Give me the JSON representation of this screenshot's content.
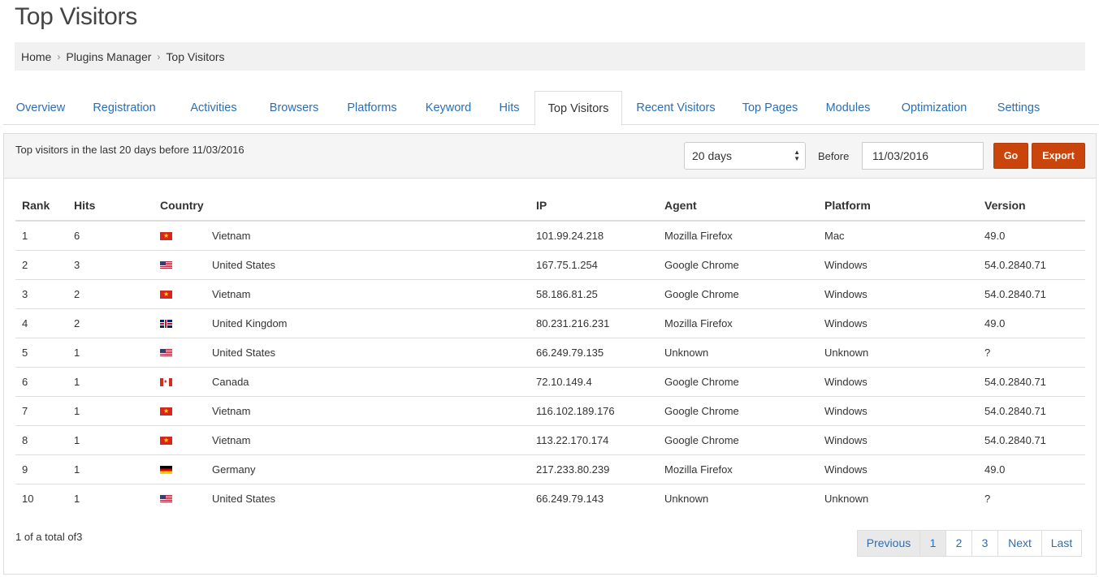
{
  "page": {
    "title": "Top Visitors"
  },
  "breadcrumb": [
    "Home",
    "Plugins Manager",
    "Top Visitors"
  ],
  "tabs": [
    {
      "label": "Overview"
    },
    {
      "label": "Registration"
    },
    {
      "label": "Activities"
    },
    {
      "label": "Browsers"
    },
    {
      "label": "Platforms"
    },
    {
      "label": "Keyword"
    },
    {
      "label": "Hits"
    },
    {
      "label": "Top Visitors",
      "active": true
    },
    {
      "label": "Recent Visitors"
    },
    {
      "label": "Top Pages"
    },
    {
      "label": "Modules"
    },
    {
      "label": "Optimization"
    },
    {
      "label": "Settings"
    }
  ],
  "filter": {
    "description": "Top visitors in the last 20 days before 11/03/2016",
    "days_selected": "20 days",
    "before_label": "Before",
    "date_value": "11/03/2016",
    "go_label": "Go",
    "export_label": "Export"
  },
  "table": {
    "headers": [
      "Rank",
      "Hits",
      "Country",
      "IP",
      "Agent",
      "Platform",
      "Version"
    ],
    "rows": [
      {
        "rank": "1",
        "hits": "6",
        "flag": "vn",
        "country": "Vietnam",
        "ip": "101.99.24.218",
        "agent": "Mozilla Firefox",
        "platform": "Mac",
        "version": "49.0"
      },
      {
        "rank": "2",
        "hits": "3",
        "flag": "us",
        "country": "United States",
        "ip": "167.75.1.254",
        "agent": "Google Chrome",
        "platform": "Windows",
        "version": "54.0.2840.71"
      },
      {
        "rank": "3",
        "hits": "2",
        "flag": "vn",
        "country": "Vietnam",
        "ip": "58.186.81.25",
        "agent": "Google Chrome",
        "platform": "Windows",
        "version": "54.0.2840.71"
      },
      {
        "rank": "4",
        "hits": "2",
        "flag": "gb",
        "country": "United Kingdom",
        "ip": "80.231.216.231",
        "agent": "Mozilla Firefox",
        "platform": "Windows",
        "version": "49.0"
      },
      {
        "rank": "5",
        "hits": "1",
        "flag": "us",
        "country": "United States",
        "ip": "66.249.79.135",
        "agent": "Unknown",
        "platform": "Unknown",
        "version": "?"
      },
      {
        "rank": "6",
        "hits": "1",
        "flag": "ca",
        "country": "Canada",
        "ip": "72.10.149.4",
        "agent": "Google Chrome",
        "platform": "Windows",
        "version": "54.0.2840.71"
      },
      {
        "rank": "7",
        "hits": "1",
        "flag": "vn",
        "country": "Vietnam",
        "ip": "116.102.189.176",
        "agent": "Google Chrome",
        "platform": "Windows",
        "version": "54.0.2840.71"
      },
      {
        "rank": "8",
        "hits": "1",
        "flag": "vn",
        "country": "Vietnam",
        "ip": "113.22.170.174",
        "agent": "Google Chrome",
        "platform": "Windows",
        "version": "54.0.2840.71"
      },
      {
        "rank": "9",
        "hits": "1",
        "flag": "de",
        "country": "Germany",
        "ip": "217.233.80.239",
        "agent": "Mozilla Firefox",
        "platform": "Windows",
        "version": "49.0"
      },
      {
        "rank": "10",
        "hits": "1",
        "flag": "us",
        "country": "United States",
        "ip": "66.249.79.143",
        "agent": "Unknown",
        "platform": "Unknown",
        "version": "?"
      }
    ]
  },
  "footer": {
    "total_text": "1 of a total of3",
    "pagination": [
      "Previous",
      "1",
      "2",
      "3",
      "Next",
      "Last"
    ]
  },
  "colors": {
    "accent": "#c9450c",
    "link": "#2a6fb5"
  }
}
